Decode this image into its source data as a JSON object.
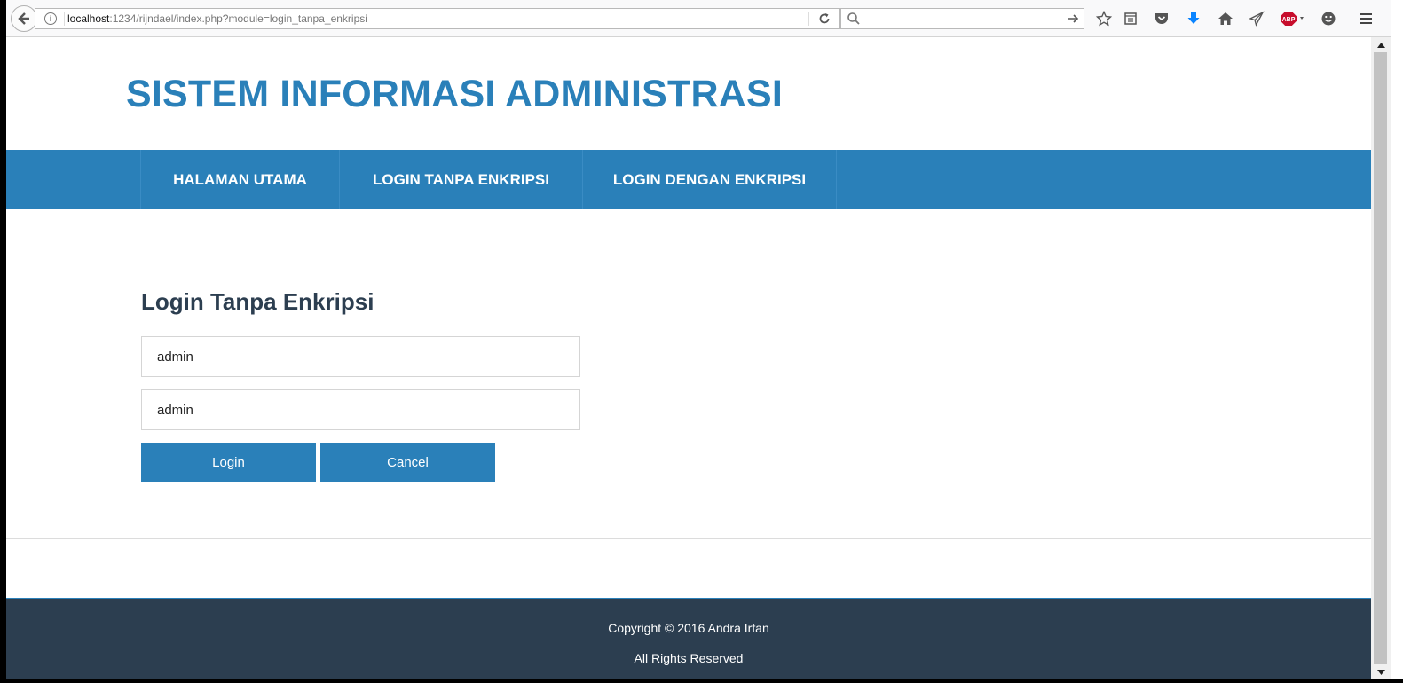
{
  "browser": {
    "url_host": "localhost",
    "url_path": ":1234/rijndael/index.php?module=login_tanpa_enkripsi",
    "search_placeholder": "",
    "abp_badge": "ABP"
  },
  "header": {
    "title": "SISTEM INFORMASI ADMINISTRASI"
  },
  "nav": {
    "items": [
      {
        "label": "HALAMAN UTAMA"
      },
      {
        "label": "LOGIN TANPA ENKRIPSI"
      },
      {
        "label": "LOGIN DENGAN ENKRIPSI"
      }
    ]
  },
  "login": {
    "title": "Login Tanpa Enkripsi",
    "username_value": "admin",
    "password_value": "admin",
    "login_label": "Login",
    "cancel_label": "Cancel"
  },
  "footer": {
    "copyright": "Copyright © 2016 Andra Irfan",
    "rights": "All Rights Reserved"
  },
  "colors": {
    "primary": "#2a80b9",
    "dark": "#2c3e50"
  }
}
